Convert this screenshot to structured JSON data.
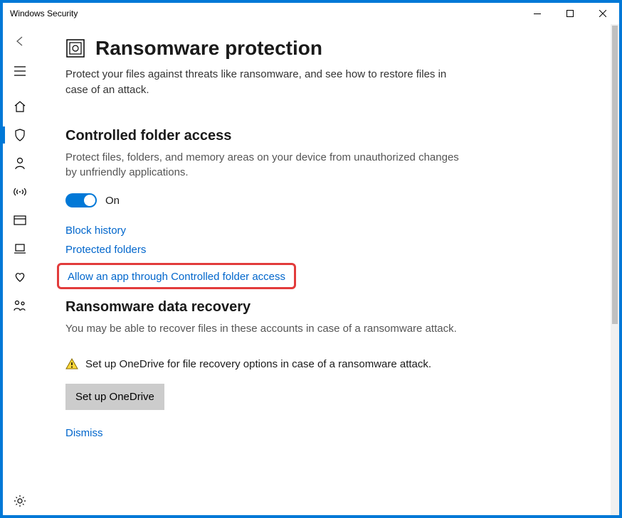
{
  "window": {
    "title": "Windows Security"
  },
  "page": {
    "heading": "Ransomware protection",
    "subtitle": "Protect your files against threats like ransomware, and see how to restore files in case of an attack."
  },
  "cfa": {
    "heading": "Controlled folder access",
    "desc": "Protect files, folders, and memory areas on your device from unauthorized changes by unfriendly applications.",
    "toggle_label": "On",
    "links": {
      "block_history": "Block history",
      "protected_folders": "Protected folders",
      "allow_app": "Allow an app through Controlled folder access"
    }
  },
  "recovery": {
    "heading": "Ransomware data recovery",
    "desc": "You may be able to recover files in these accounts in case of a ransomware attack.",
    "warning": "Set up OneDrive for file recovery options in case of a ransomware attack.",
    "setup_button": "Set up OneDrive",
    "dismiss": "Dismiss"
  },
  "sidebar": {
    "items": [
      {
        "name": "back",
        "icon": "back"
      },
      {
        "name": "menu",
        "icon": "menu"
      },
      {
        "name": "home",
        "icon": "home"
      },
      {
        "name": "virus",
        "icon": "shield",
        "selected": true
      },
      {
        "name": "account",
        "icon": "person"
      },
      {
        "name": "firewall",
        "icon": "network"
      },
      {
        "name": "app-browser",
        "icon": "browser"
      },
      {
        "name": "device-security",
        "icon": "device"
      },
      {
        "name": "performance",
        "icon": "heart"
      },
      {
        "name": "family",
        "icon": "family"
      },
      {
        "name": "settings",
        "icon": "gear"
      }
    ]
  }
}
